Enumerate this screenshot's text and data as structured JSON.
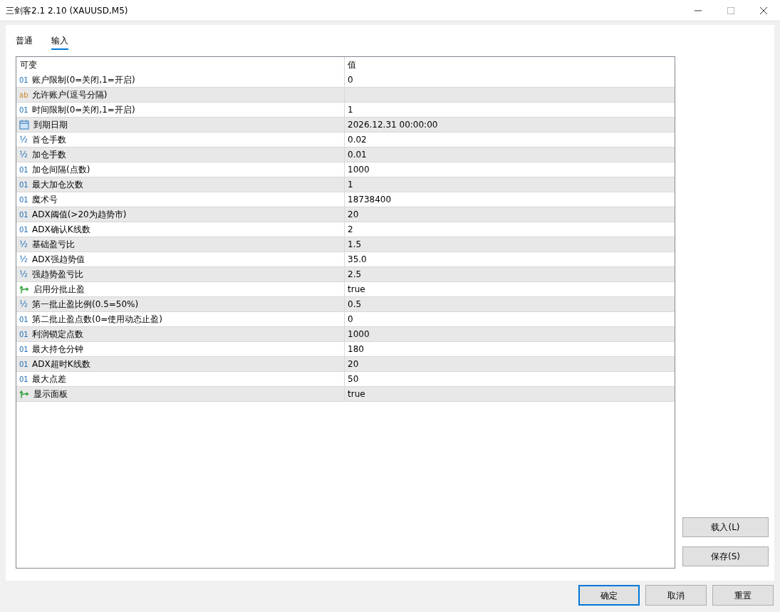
{
  "window": {
    "title": "三剑客2.1 2.10 (XAUUSD,M5)"
  },
  "tabs": [
    {
      "label": "普通",
      "selected": false
    },
    {
      "label": "输入",
      "selected": true
    }
  ],
  "table": {
    "columns": [
      "可变",
      "值"
    ],
    "rows": [
      {
        "kind": "int",
        "icon": "01",
        "name": "账户限制(0=关闭,1=开启)",
        "value": "0"
      },
      {
        "kind": "string",
        "icon": "ab",
        "name": "允许账户(逗号分隔)"
      },
      {
        "kind": "int",
        "icon": "01",
        "name": "时间限制(0=关闭,1=开启)",
        "value": "1"
      },
      {
        "kind": "datetime",
        "name": "到期日期",
        "value": "2026.12.31 00:00:00"
      },
      {
        "kind": "double",
        "icon": "½",
        "name": "首仓手数",
        "value": "0.02"
      },
      {
        "kind": "double",
        "icon": "½",
        "name": "加仓手数",
        "value": "0.01"
      },
      {
        "kind": "int",
        "icon": "01",
        "name": "加仓间隔(点数)",
        "value": "1000"
      },
      {
        "kind": "int",
        "icon": "01",
        "name": "最大加仓次数",
        "value": "1"
      },
      {
        "kind": "int",
        "icon": "01",
        "name": "魔术号",
        "value": "18738400"
      },
      {
        "kind": "int",
        "icon": "01",
        "name": "ADX阈值(>20为趋势市)",
        "value": "20"
      },
      {
        "kind": "int",
        "icon": "01",
        "name": "ADX确认K线数",
        "value": "2"
      },
      {
        "kind": "double",
        "icon": "½",
        "name": "基础盈亏比",
        "value": "1.5"
      },
      {
        "kind": "double",
        "icon": "½",
        "name": "ADX强趋势值",
        "value": "35.0"
      },
      {
        "kind": "double",
        "icon": "½",
        "name": "强趋势盈亏比",
        "value": "2.5"
      },
      {
        "kind": "bool",
        "name": "启用分批止盈",
        "value": "true"
      },
      {
        "kind": "double",
        "icon": "½",
        "name": "第一批止盈比例(0.5=50%)",
        "value": "0.5"
      },
      {
        "kind": "int",
        "icon": "01",
        "name": "第二批止盈点数(0=使用动态止盈)",
        "value": "0"
      },
      {
        "kind": "int",
        "icon": "01",
        "name": "利润锁定点数",
        "value": "1000"
      },
      {
        "kind": "int",
        "icon": "01",
        "name": "最大持仓分钟",
        "value": "180"
      },
      {
        "kind": "int",
        "icon": "01",
        "name": "ADX超时K线数",
        "value": "20"
      },
      {
        "kind": "int",
        "icon": "01",
        "name": "最大点差",
        "value": "50"
      },
      {
        "kind": "bool",
        "name": "显示面板",
        "value": "true"
      }
    ]
  },
  "side_buttons": [
    "载入(L)",
    "保存(S)"
  ],
  "footer_buttons": [
    {
      "label": "确定",
      "default": true
    },
    {
      "label": "取消",
      "default": false
    },
    {
      "label": "重置",
      "default": false
    }
  ]
}
